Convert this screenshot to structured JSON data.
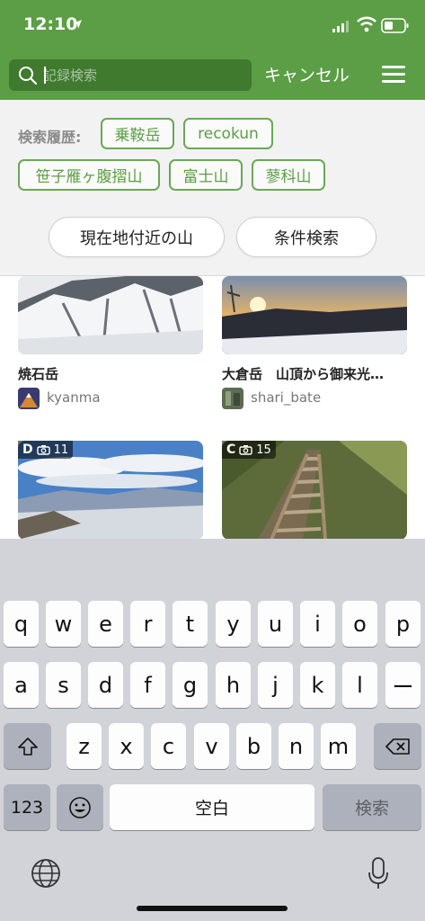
{
  "status_bar": {
    "time": "12:10"
  },
  "search": {
    "placeholder": "記録検索",
    "value": "",
    "cancel_label": "キャンセル"
  },
  "history": {
    "label": "検索履歴:",
    "chips": [
      "乗鞍岳",
      "recokun",
      "笹子雁ヶ腹摺山",
      "富士山",
      "蓼科山"
    ]
  },
  "filters": {
    "nearby_label": "現在地付近の山",
    "condition_label": "条件検索"
  },
  "records": [
    {
      "title": "焼石岳",
      "user": "kyanma"
    },
    {
      "title": "大倉岳　山頂から御来光…",
      "user": "shari_bate"
    },
    {
      "grade": "D",
      "photo_count": "11"
    },
    {
      "grade": "C",
      "photo_count": "15"
    }
  ],
  "keyboard": {
    "row1": [
      "q",
      "w",
      "e",
      "r",
      "t",
      "y",
      "u",
      "i",
      "o",
      "p"
    ],
    "row2": [
      "a",
      "s",
      "d",
      "f",
      "g",
      "h",
      "j",
      "k",
      "l",
      "ー"
    ],
    "row3": [
      "z",
      "x",
      "c",
      "v",
      "b",
      "n",
      "m"
    ],
    "numbers_label": "123",
    "space_label": "空白",
    "search_label": "検索"
  },
  "colors": {
    "header_green": "#5b9e45",
    "chip_green": "#6aa856",
    "keyboard_bg": "#d1d3d9"
  }
}
